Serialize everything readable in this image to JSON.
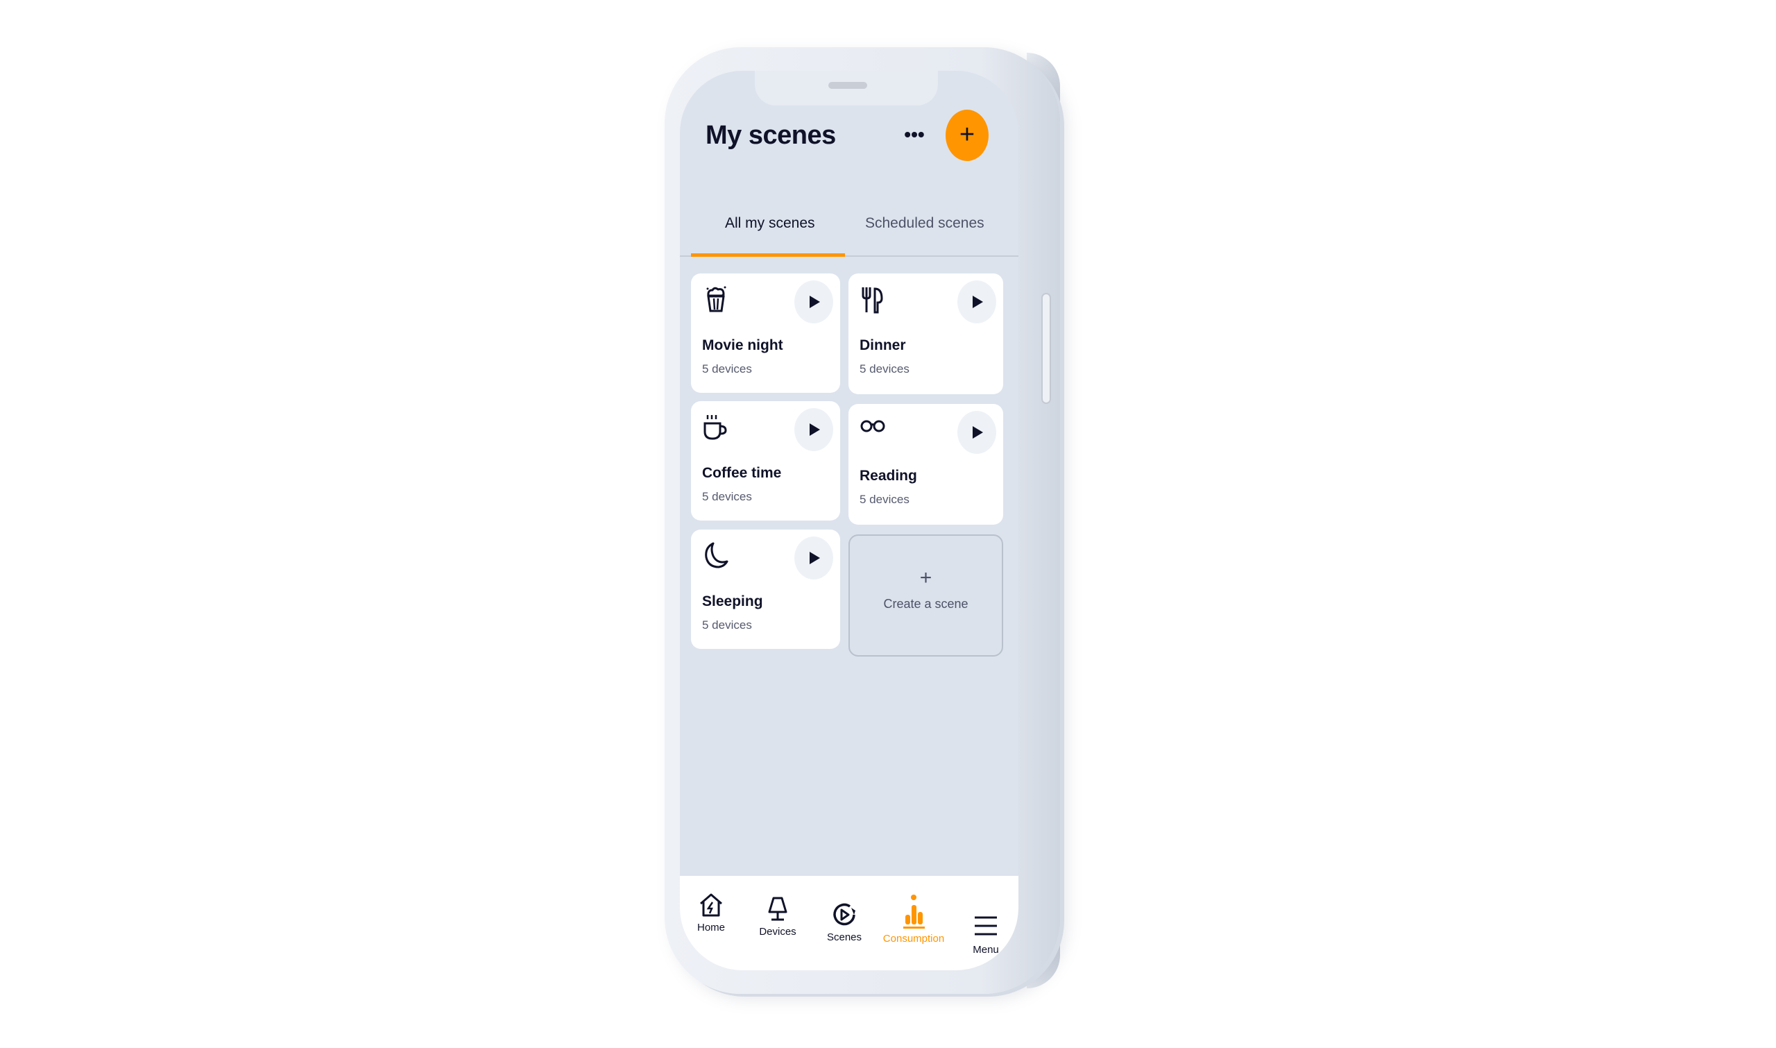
{
  "header": {
    "title": "My scenes",
    "more_label": "•••",
    "add_label": "+"
  },
  "tabs": [
    {
      "label": "All my scenes",
      "active": true
    },
    {
      "label": "Scheduled scenes",
      "active": false
    }
  ],
  "scenes": [
    {
      "name": "Movie night",
      "devices": "5 devices",
      "icon": "popcorn-icon"
    },
    {
      "name": "Dinner",
      "devices": "5 devices",
      "icon": "fork-knife-icon"
    },
    {
      "name": "Coffee time",
      "devices": "5 devices",
      "icon": "coffee-cup-icon"
    },
    {
      "name": "Reading",
      "devices": "5 devices",
      "icon": "glasses-icon"
    },
    {
      "name": "Sleeping",
      "devices": "5 devices",
      "icon": "moon-icon"
    }
  ],
  "create_scene": {
    "plus": "+",
    "label": "Create a scene"
  },
  "nav": [
    {
      "label": "Home",
      "icon": "home-bolt-icon",
      "active": false
    },
    {
      "label": "Devices",
      "icon": "lamp-icon",
      "active": false
    },
    {
      "label": "Scenes",
      "icon": "scene-play-icon",
      "active": false
    },
    {
      "label": "Consumption",
      "icon": "bar-chart-icon",
      "active": true
    },
    {
      "label": "Menu",
      "icon": "hamburger-icon",
      "active": false
    }
  ],
  "colors": {
    "accent": "#ff9500",
    "screen_bg": "#dce3ed",
    "text": "#0f1228",
    "muted": "#555a6e"
  }
}
